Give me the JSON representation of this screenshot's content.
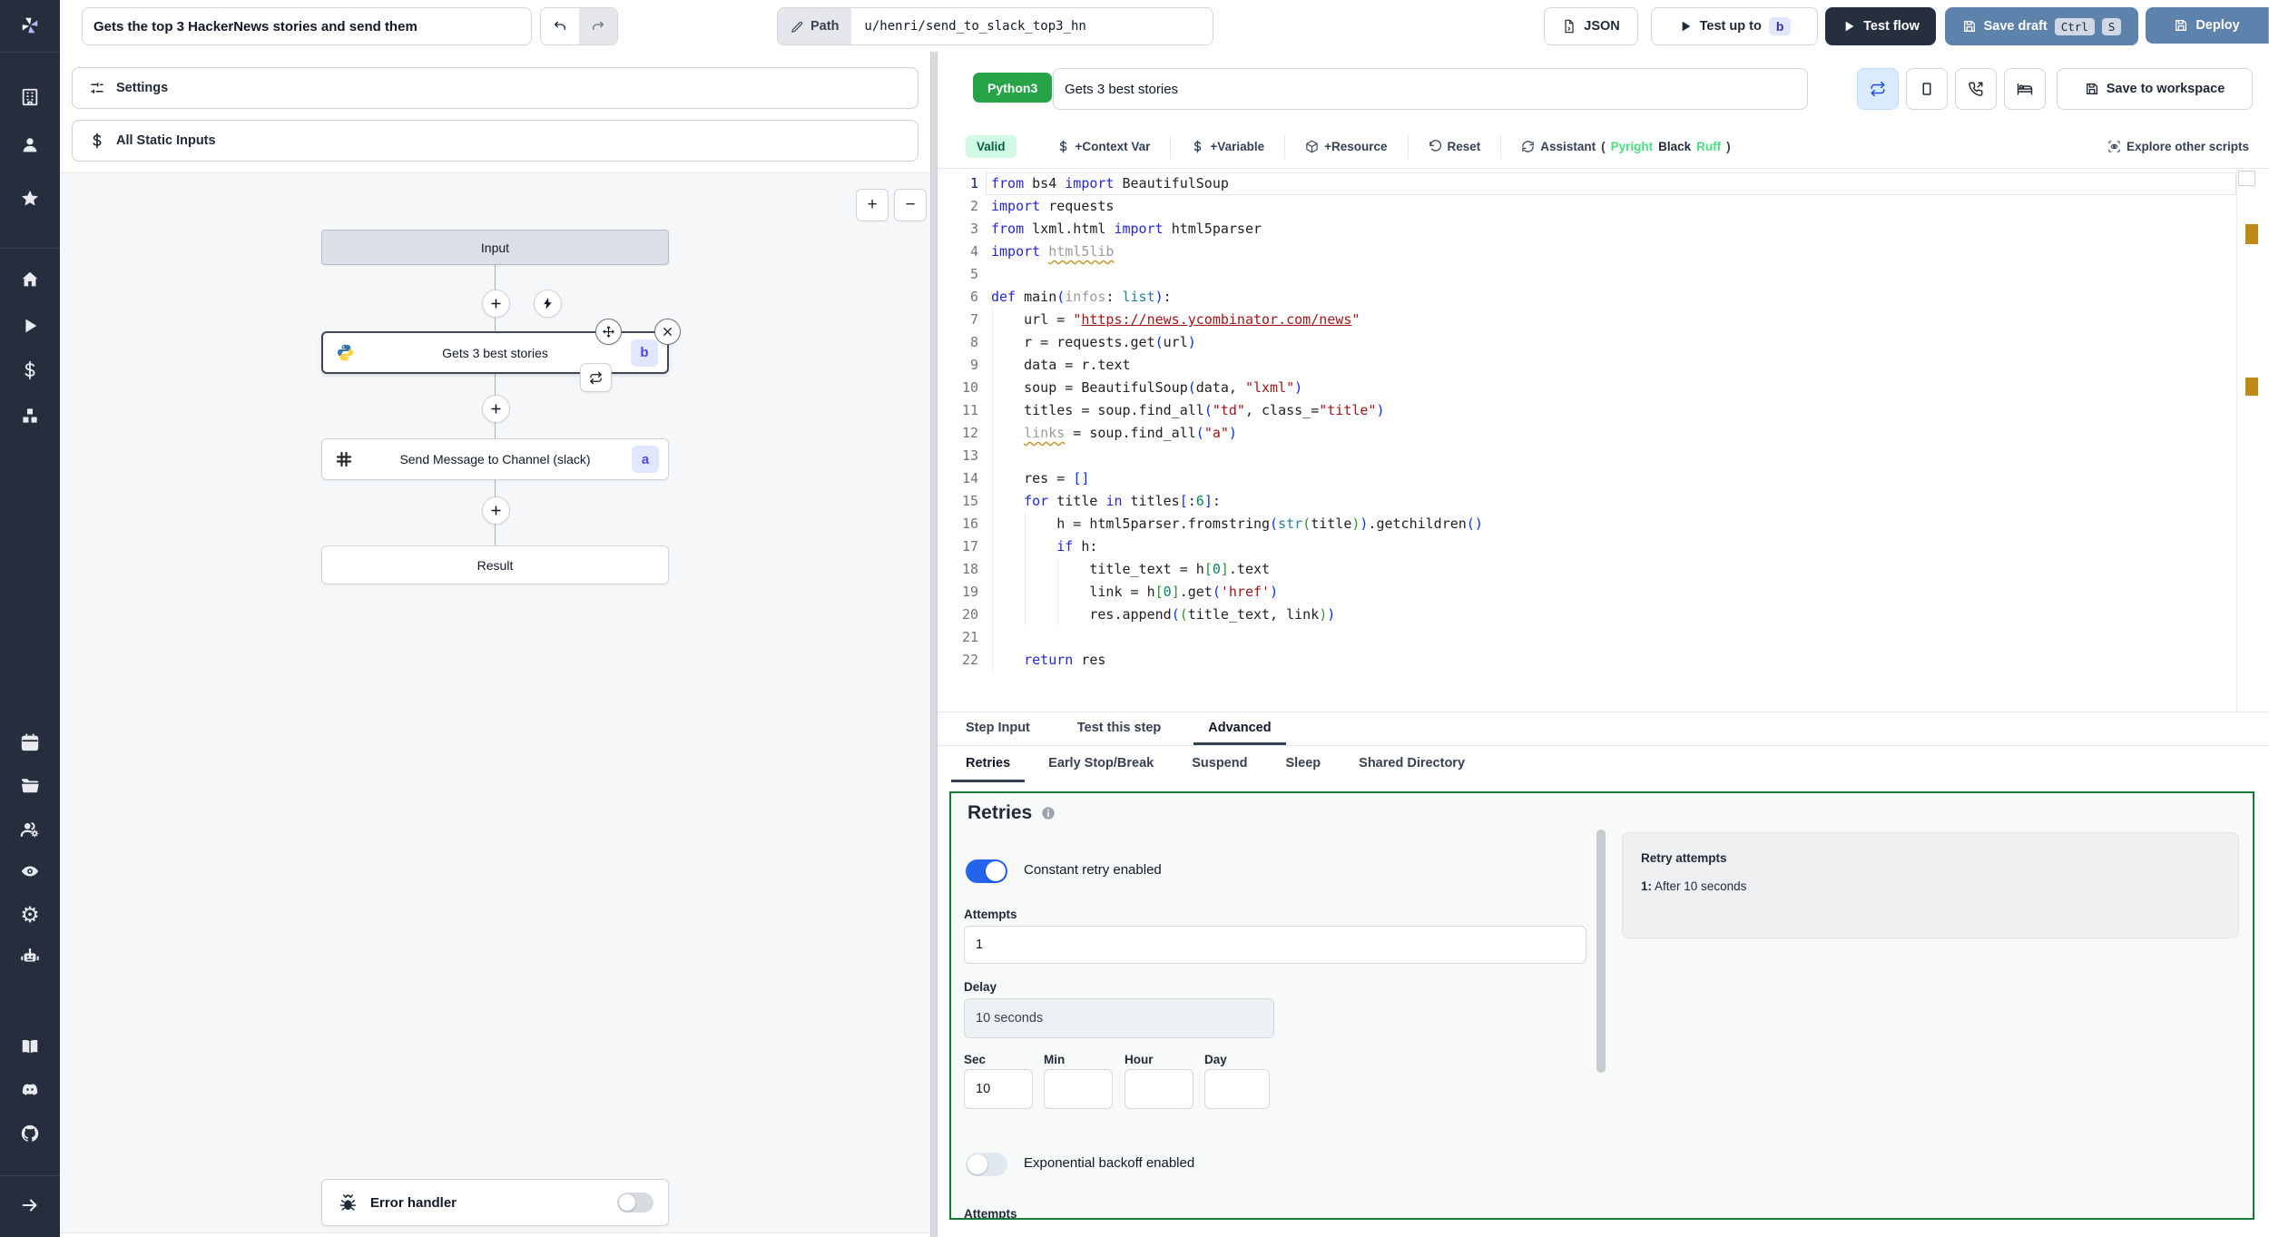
{
  "colors": {
    "sidebar_bg": "#262e3d",
    "accent_green": "#137a38",
    "python_badge": "#27a348",
    "toggle_on_blue": "#2563eb",
    "steel_button": "#5d82ab",
    "dark_button": "#252f3e",
    "node_badge_bg": "#e0e7ff",
    "warning_marker": "#bf8a18"
  },
  "sidebar": {
    "icons": [
      "buildings",
      "user",
      "star",
      "home",
      "play",
      "dollar",
      "boxes",
      "calendar",
      "folder-open",
      "users-cog",
      "eye",
      "settings-gear",
      "bot",
      "book-open",
      "discord",
      "github"
    ],
    "logo": "windmill-logo",
    "collapse": "arrow-right"
  },
  "topbar": {
    "title_value": "Gets the top 3 HackerNews stories and send them",
    "path_label": "Path",
    "path_value": "u/henri/send_to_slack_top3_hn",
    "json_label": "JSON",
    "test_up_to_label": "Test up to",
    "test_up_to_badge": "b",
    "test_flow_label": "Test flow",
    "save_draft_label": "Save draft",
    "kbd_ctrl": "Ctrl",
    "kbd_s": "S",
    "deploy_label": "Deploy"
  },
  "flow": {
    "settings_label": "Settings",
    "static_inputs_label": "All Static Inputs",
    "zoom_in": "+",
    "zoom_out": "−",
    "input_node": "Input",
    "step1_label": "Gets 3 best stories",
    "step1_badge": "b",
    "step2_label": "Send Message to Channel (slack)",
    "step2_badge": "a",
    "result_node": "Result",
    "error_handler_label": "Error handler"
  },
  "editor": {
    "language_badge": "Python3",
    "step_title": "Gets 3 best stories",
    "save_to_workspace": "Save to workspace",
    "toolbar": {
      "valid": "Valid",
      "context_var": "+Context Var",
      "variable": "+Variable",
      "resource": "+Resource",
      "reset": "Reset",
      "assistant": "Assistant",
      "assistant_open": "(",
      "assistant_pyright": "Pyright",
      "assistant_black": "Black",
      "assistant_ruff": "Ruff",
      "assistant_close": ")",
      "explore": "Explore other scripts"
    },
    "code": {
      "lines": [
        {
          "n": "1",
          "seg": [
            [
              "k",
              "from "
            ],
            [
              "p",
              "bs4 "
            ],
            [
              "k",
              "import "
            ],
            [
              "p",
              "BeautifulSoup"
            ]
          ]
        },
        {
          "n": "2",
          "seg": [
            [
              "k",
              "import "
            ],
            [
              "p",
              "requests"
            ]
          ]
        },
        {
          "n": "3",
          "seg": [
            [
              "k",
              "from "
            ],
            [
              "p",
              "lxml.html "
            ],
            [
              "k",
              "import "
            ],
            [
              "p",
              "html5parser"
            ]
          ]
        },
        {
          "n": "4",
          "seg": [
            [
              "k",
              "import "
            ],
            [
              "w",
              "html5lib"
            ]
          ]
        },
        {
          "n": "5",
          "seg": []
        },
        {
          "n": "6",
          "seg": [
            [
              "k",
              "def "
            ],
            [
              "f",
              "main"
            ],
            [
              "b1",
              "("
            ],
            [
              "g",
              "infos"
            ],
            [
              "p",
              ": "
            ],
            [
              "t",
              "list"
            ],
            [
              "b1",
              ")"
            ],
            [
              "p",
              ":"
            ]
          ]
        },
        {
          "n": "7",
          "seg": [
            [
              "p",
              "    url = "
            ],
            [
              "s",
              "\""
            ],
            [
              "su",
              "https://news.ycombinator.com/news"
            ],
            [
              "s",
              "\""
            ]
          ]
        },
        {
          "n": "8",
          "seg": [
            [
              "p",
              "    r = requests.get"
            ],
            [
              "b1",
              "("
            ],
            [
              "p",
              "url"
            ],
            [
              "b1",
              ")"
            ]
          ]
        },
        {
          "n": "9",
          "seg": [
            [
              "p",
              "    data = r.text"
            ]
          ]
        },
        {
          "n": "10",
          "seg": [
            [
              "p",
              "    soup = BeautifulSoup"
            ],
            [
              "b1",
              "("
            ],
            [
              "p",
              "data, "
            ],
            [
              "s",
              "\"lxml\""
            ],
            [
              "b1",
              ")"
            ]
          ]
        },
        {
          "n": "11",
          "seg": [
            [
              "p",
              "    titles = soup.find_all"
            ],
            [
              "b1",
              "("
            ],
            [
              "s",
              "\"td\""
            ],
            [
              "p",
              ", class_="
            ],
            [
              "s",
              "\"title\""
            ],
            [
              "b1",
              ")"
            ]
          ]
        },
        {
          "n": "12",
          "seg": [
            [
              "p",
              "    "
            ],
            [
              "w",
              "links"
            ],
            [
              "p",
              " = soup.find_all"
            ],
            [
              "b1",
              "("
            ],
            [
              "s",
              "\"a\""
            ],
            [
              "b1",
              ")"
            ]
          ]
        },
        {
          "n": "13",
          "seg": []
        },
        {
          "n": "14",
          "seg": [
            [
              "p",
              "    res = "
            ],
            [
              "b1",
              "[]"
            ]
          ]
        },
        {
          "n": "15",
          "seg": [
            [
              "p",
              "    "
            ],
            [
              "k",
              "for"
            ],
            [
              "p",
              " title "
            ],
            [
              "k",
              "in"
            ],
            [
              "p",
              " titles"
            ],
            [
              "b1",
              "["
            ],
            [
              "p",
              ":"
            ],
            [
              "n",
              "6"
            ],
            [
              "b1",
              "]"
            ],
            [
              "p",
              ":"
            ]
          ]
        },
        {
          "n": "16",
          "seg": [
            [
              "p",
              "        h = html5parser.fromstring"
            ],
            [
              "b1",
              "("
            ],
            [
              "t",
              "str"
            ],
            [
              "b2",
              "("
            ],
            [
              "p",
              "title"
            ],
            [
              "b2",
              ")"
            ],
            [
              "b1",
              ")"
            ],
            [
              "p",
              ".getchildren"
            ],
            [
              "b1",
              "()"
            ]
          ]
        },
        {
          "n": "17",
          "seg": [
            [
              "p",
              "        "
            ],
            [
              "k",
              "if"
            ],
            [
              "p",
              " h:"
            ]
          ]
        },
        {
          "n": "18",
          "seg": [
            [
              "p",
              "            title_text = h"
            ],
            [
              "b2",
              "["
            ],
            [
              "n",
              "0"
            ],
            [
              "b2",
              "]"
            ],
            [
              "p",
              ".text"
            ]
          ]
        },
        {
          "n": "19",
          "seg": [
            [
              "p",
              "            link = h"
            ],
            [
              "b2",
              "["
            ],
            [
              "n",
              "0"
            ],
            [
              "b2",
              "]"
            ],
            [
              "p",
              ".get"
            ],
            [
              "b1",
              "("
            ],
            [
              "s",
              "'href'"
            ],
            [
              "b1",
              ")"
            ]
          ]
        },
        {
          "n": "20",
          "seg": [
            [
              "p",
              "            res.append"
            ],
            [
              "b1",
              "("
            ],
            [
              "b2",
              "("
            ],
            [
              "p",
              "title_text, link"
            ],
            [
              "b2",
              ")"
            ],
            [
              "b1",
              ")"
            ]
          ]
        },
        {
          "n": "21",
          "seg": []
        },
        {
          "n": "22",
          "seg": [
            [
              "p",
              "    "
            ],
            [
              "k",
              "return"
            ],
            [
              "p",
              " res"
            ]
          ]
        }
      ]
    }
  },
  "tabs": {
    "primary": [
      {
        "label": "Step Input",
        "active": false
      },
      {
        "label": "Test this step",
        "active": false
      },
      {
        "label": "Advanced",
        "active": true
      }
    ],
    "secondary": [
      {
        "label": "Retries",
        "active": true
      },
      {
        "label": "Early Stop/Break",
        "active": false
      },
      {
        "label": "Suspend",
        "active": false
      },
      {
        "label": "Sleep",
        "active": false
      },
      {
        "label": "Shared Directory",
        "active": false
      }
    ]
  },
  "retries": {
    "heading": "Retries",
    "constant_label": "Constant retry enabled",
    "attempts_label": "Attempts",
    "attempts_value": "1",
    "delay_label": "Delay",
    "delay_value": "10 seconds",
    "units": [
      {
        "label": "Sec",
        "value": "10"
      },
      {
        "label": "Min",
        "value": ""
      },
      {
        "label": "Hour",
        "value": ""
      },
      {
        "label": "Day",
        "value": ""
      }
    ],
    "exponential_label": "Exponential backoff enabled",
    "clipped_label": "Attempts",
    "preview_title": "Retry attempts",
    "preview_prefix": "1:",
    "preview_text": "After 10 seconds"
  }
}
